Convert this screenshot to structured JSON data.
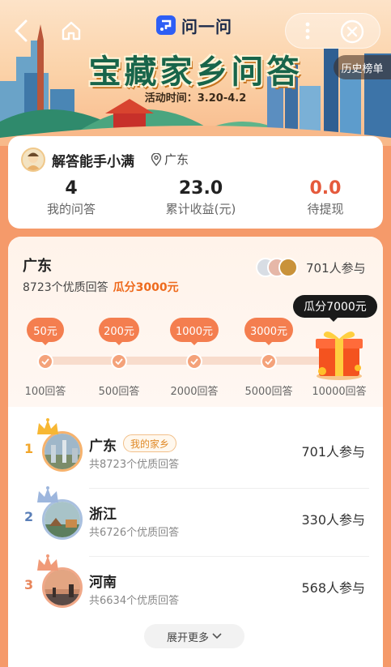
{
  "header": {
    "brand_name": "问一问",
    "title": "宝藏家乡问答",
    "activity_time": "活动时间：3.20-4.2",
    "history_label": "历史榜单"
  },
  "user": {
    "name": "解答能手小满",
    "location": "广东",
    "stats": [
      {
        "value": "4",
        "label": "我的问答"
      },
      {
        "value": "23.0",
        "label": "累计收益(元)"
      },
      {
        "value": "0.0",
        "label": "待提现"
      }
    ]
  },
  "region": {
    "name": "广东",
    "quality_answers": "8723个优质回答",
    "reward_pool": "瓜分3000元",
    "participants": "701人参与",
    "final_reward": "瓜分7000元",
    "milestones": [
      {
        "reward": "50元",
        "target": "100回答"
      },
      {
        "reward": "200元",
        "target": "500回答"
      },
      {
        "reward": "1000元",
        "target": "2000回答"
      },
      {
        "reward": "3000元",
        "target": "5000回答"
      },
      {
        "reward": "",
        "target": "10000回答"
      }
    ]
  },
  "ranking": [
    {
      "rank": "1",
      "name": "广东",
      "tag": "我的家乡",
      "sub": "共8723个优质回答",
      "count": "701人参与",
      "color": "#f2a62a"
    },
    {
      "rank": "2",
      "name": "浙江",
      "tag": "",
      "sub": "共6726个优质回答",
      "count": "330人参与",
      "color": "#5a7fb8"
    },
    {
      "rank": "3",
      "name": "河南",
      "tag": "",
      "sub": "共6634个优质回答",
      "count": "568人参与",
      "color": "#e8855a"
    }
  ],
  "expand_label": "展开更多"
}
